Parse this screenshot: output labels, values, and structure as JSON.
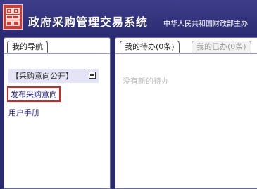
{
  "header": {
    "title": "政府采购管理交易系统",
    "subtitle": "中华人民共和国财政部主办",
    "logo_icon": "seal-logo-icon"
  },
  "left_panel": {
    "tab_label": "我的导航",
    "section": {
      "label": "【采购意向公开】",
      "collapse_icon": "minus-box-icon",
      "items": [
        {
          "label": "发布采购意向",
          "selected": true
        }
      ]
    },
    "extra_items": [
      {
        "label": "用户手册"
      }
    ]
  },
  "right_panel": {
    "tabs": [
      {
        "label": "我的待办(0条)",
        "active": true
      },
      {
        "label": "我的已办(0条)",
        "active": false
      }
    ],
    "empty_text": "没有新的待办"
  },
  "colors": {
    "header_bg": "#2b2b72",
    "logo_red": "#cf3b30",
    "selected_border": "#dd2222",
    "section_bg": "#e4e4f6"
  }
}
